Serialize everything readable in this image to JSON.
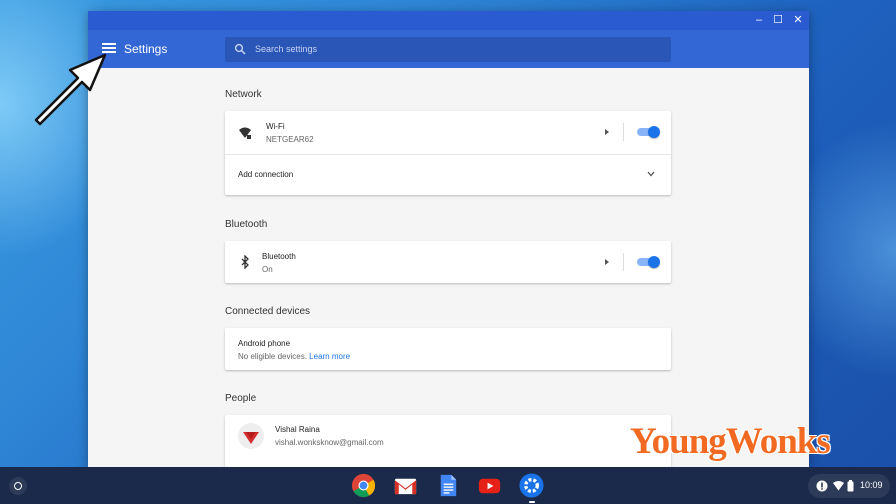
{
  "window": {
    "title": "Settings",
    "controls": {
      "minimize": "–",
      "maximize": "☐",
      "close": "✕"
    }
  },
  "search": {
    "placeholder": "Search settings"
  },
  "network": {
    "title": "Network",
    "wifi_label": "Wi-Fi",
    "wifi_network": "NETGEAR62",
    "wifi_enabled": true,
    "add_connection": "Add connection"
  },
  "bluetooth": {
    "title": "Bluetooth",
    "label": "Bluetooth",
    "status": "On",
    "enabled": true
  },
  "connected_devices": {
    "title": "Connected devices",
    "android_label": "Android phone",
    "android_status": "No eligible devices.",
    "learn_more": "Learn more"
  },
  "people": {
    "title": "People",
    "name": "Vishal Raina",
    "email": "vishal.wonksknow@gmail.com"
  },
  "shelf": {
    "apps": [
      "chrome-icon",
      "gmail-icon",
      "docs-icon",
      "youtube-icon",
      "settings-icon"
    ],
    "time": "10:09"
  },
  "watermark": "YoungWonks",
  "colors": {
    "header": "#3367d6",
    "titlebar": "#2a5bd0",
    "accent": "#1a73e8",
    "watermark": "#f26a22"
  }
}
